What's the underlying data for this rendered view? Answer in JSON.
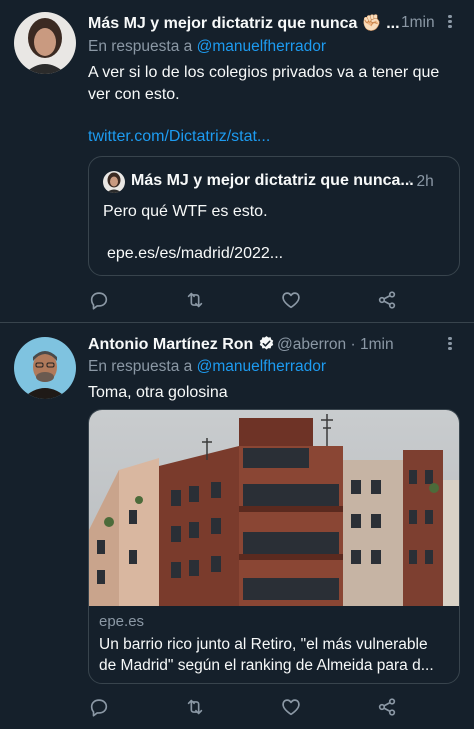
{
  "tweets": [
    {
      "author_name": "Más MJ y mejor dictatriz que nunca ✊🏻 ...",
      "time": "1min",
      "reply_prefix": "En respuesta a",
      "reply_handle": "@manuelfherrador",
      "text_line1": "A ver si lo de los colegios privados va a tener que",
      "text_line2": "ver con esto.",
      "link": "twitter.com/Dictatriz/stat...",
      "quote": {
        "author_name": "Más MJ y mejor dictatriz que nunca...",
        "separator": "·",
        "time": "2h",
        "text": "Pero qué WTF es esto.",
        "link": "epe.es/es/madrid/2022..."
      }
    },
    {
      "author_name": "Antonio Martínez Ron",
      "handle": "@aberron",
      "separator": "·",
      "time": "1min",
      "reply_prefix": "En respuesta a",
      "reply_handle": "@manuelfherrador",
      "text": "Toma, otra golosina",
      "card": {
        "domain": "epe.es",
        "title_line1": "Un barrio rico junto al Retiro, \"el más vulnerable",
        "title_line2": "de Madrid\" según el ranking de Almeida para d..."
      }
    }
  ],
  "icons": {
    "reply": "reply-icon",
    "retweet": "retweet-icon",
    "like": "heart-icon",
    "share": "share-icon",
    "more": "more-icon",
    "verified": "verified-badge-icon"
  },
  "colors": {
    "background": "#15202b",
    "accent": "#1d9bf0",
    "secondary_text": "#8b98a5",
    "border": "#38444d"
  }
}
